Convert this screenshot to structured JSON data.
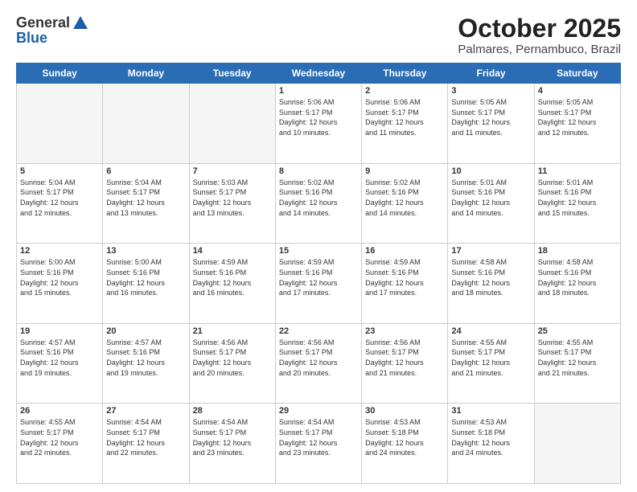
{
  "header": {
    "logo_general": "General",
    "logo_blue": "Blue",
    "month_title": "October 2025",
    "location": "Palmares, Pernambuco, Brazil"
  },
  "weekdays": [
    "Sunday",
    "Monday",
    "Tuesday",
    "Wednesday",
    "Thursday",
    "Friday",
    "Saturday"
  ],
  "weeks": [
    [
      {
        "day": "",
        "info": ""
      },
      {
        "day": "",
        "info": ""
      },
      {
        "day": "",
        "info": ""
      },
      {
        "day": "1",
        "info": "Sunrise: 5:06 AM\nSunset: 5:17 PM\nDaylight: 12 hours\nand 10 minutes."
      },
      {
        "day": "2",
        "info": "Sunrise: 5:06 AM\nSunset: 5:17 PM\nDaylight: 12 hours\nand 11 minutes."
      },
      {
        "day": "3",
        "info": "Sunrise: 5:05 AM\nSunset: 5:17 PM\nDaylight: 12 hours\nand 11 minutes."
      },
      {
        "day": "4",
        "info": "Sunrise: 5:05 AM\nSunset: 5:17 PM\nDaylight: 12 hours\nand 12 minutes."
      }
    ],
    [
      {
        "day": "5",
        "info": "Sunrise: 5:04 AM\nSunset: 5:17 PM\nDaylight: 12 hours\nand 12 minutes."
      },
      {
        "day": "6",
        "info": "Sunrise: 5:04 AM\nSunset: 5:17 PM\nDaylight: 12 hours\nand 13 minutes."
      },
      {
        "day": "7",
        "info": "Sunrise: 5:03 AM\nSunset: 5:17 PM\nDaylight: 12 hours\nand 13 minutes."
      },
      {
        "day": "8",
        "info": "Sunrise: 5:02 AM\nSunset: 5:16 PM\nDaylight: 12 hours\nand 14 minutes."
      },
      {
        "day": "9",
        "info": "Sunrise: 5:02 AM\nSunset: 5:16 PM\nDaylight: 12 hours\nand 14 minutes."
      },
      {
        "day": "10",
        "info": "Sunrise: 5:01 AM\nSunset: 5:16 PM\nDaylight: 12 hours\nand 14 minutes."
      },
      {
        "day": "11",
        "info": "Sunrise: 5:01 AM\nSunset: 5:16 PM\nDaylight: 12 hours\nand 15 minutes."
      }
    ],
    [
      {
        "day": "12",
        "info": "Sunrise: 5:00 AM\nSunset: 5:16 PM\nDaylight: 12 hours\nand 15 minutes."
      },
      {
        "day": "13",
        "info": "Sunrise: 5:00 AM\nSunset: 5:16 PM\nDaylight: 12 hours\nand 16 minutes."
      },
      {
        "day": "14",
        "info": "Sunrise: 4:59 AM\nSunset: 5:16 PM\nDaylight: 12 hours\nand 16 minutes."
      },
      {
        "day": "15",
        "info": "Sunrise: 4:59 AM\nSunset: 5:16 PM\nDaylight: 12 hours\nand 17 minutes."
      },
      {
        "day": "16",
        "info": "Sunrise: 4:59 AM\nSunset: 5:16 PM\nDaylight: 12 hours\nand 17 minutes."
      },
      {
        "day": "17",
        "info": "Sunrise: 4:58 AM\nSunset: 5:16 PM\nDaylight: 12 hours\nand 18 minutes."
      },
      {
        "day": "18",
        "info": "Sunrise: 4:58 AM\nSunset: 5:16 PM\nDaylight: 12 hours\nand 18 minutes."
      }
    ],
    [
      {
        "day": "19",
        "info": "Sunrise: 4:57 AM\nSunset: 5:16 PM\nDaylight: 12 hours\nand 19 minutes."
      },
      {
        "day": "20",
        "info": "Sunrise: 4:57 AM\nSunset: 5:16 PM\nDaylight: 12 hours\nand 19 minutes."
      },
      {
        "day": "21",
        "info": "Sunrise: 4:56 AM\nSunset: 5:17 PM\nDaylight: 12 hours\nand 20 minutes."
      },
      {
        "day": "22",
        "info": "Sunrise: 4:56 AM\nSunset: 5:17 PM\nDaylight: 12 hours\nand 20 minutes."
      },
      {
        "day": "23",
        "info": "Sunrise: 4:56 AM\nSunset: 5:17 PM\nDaylight: 12 hours\nand 21 minutes."
      },
      {
        "day": "24",
        "info": "Sunrise: 4:55 AM\nSunset: 5:17 PM\nDaylight: 12 hours\nand 21 minutes."
      },
      {
        "day": "25",
        "info": "Sunrise: 4:55 AM\nSunset: 5:17 PM\nDaylight: 12 hours\nand 21 minutes."
      }
    ],
    [
      {
        "day": "26",
        "info": "Sunrise: 4:55 AM\nSunset: 5:17 PM\nDaylight: 12 hours\nand 22 minutes."
      },
      {
        "day": "27",
        "info": "Sunrise: 4:54 AM\nSunset: 5:17 PM\nDaylight: 12 hours\nand 22 minutes."
      },
      {
        "day": "28",
        "info": "Sunrise: 4:54 AM\nSunset: 5:17 PM\nDaylight: 12 hours\nand 23 minutes."
      },
      {
        "day": "29",
        "info": "Sunrise: 4:54 AM\nSunset: 5:17 PM\nDaylight: 12 hours\nand 23 minutes."
      },
      {
        "day": "30",
        "info": "Sunrise: 4:53 AM\nSunset: 5:18 PM\nDaylight: 12 hours\nand 24 minutes."
      },
      {
        "day": "31",
        "info": "Sunrise: 4:53 AM\nSunset: 5:18 PM\nDaylight: 12 hours\nand 24 minutes."
      },
      {
        "day": "",
        "info": ""
      }
    ]
  ]
}
